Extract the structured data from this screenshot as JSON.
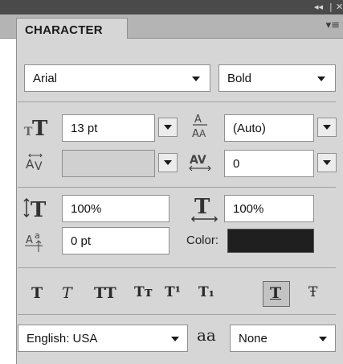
{
  "panel": {
    "title": "CHARACTER",
    "collapse_icon": "double-chevron-left-icon",
    "close_icon": "close-icon",
    "menu_icon": "panel-menu-icon"
  },
  "font": {
    "family": "Arial",
    "style": "Bold"
  },
  "metrics": {
    "size": "13 pt",
    "leading": "(Auto)",
    "kerning": "",
    "tracking": "0"
  },
  "scale": {
    "vertical": "100%",
    "horizontal": "100%",
    "baseline_shift": "0 pt",
    "color_label": "Color:",
    "color_value": "#1f1f1f"
  },
  "style_buttons": [
    {
      "name": "faux-bold-button",
      "glyph": "T"
    },
    {
      "name": "faux-italic-button",
      "glyph": "T"
    },
    {
      "name": "all-caps-button",
      "glyph": "TT"
    },
    {
      "name": "small-caps-button",
      "glyph": "Tт"
    },
    {
      "name": "superscript-button",
      "glyph": "T¹"
    },
    {
      "name": "subscript-button",
      "glyph": "T₁"
    },
    {
      "name": "underline-button",
      "glyph": "T"
    },
    {
      "name": "strikethrough-button",
      "glyph": "Ŧ"
    }
  ],
  "language": {
    "value": "English: USA",
    "aa_label": "aa",
    "antialias": "None"
  }
}
